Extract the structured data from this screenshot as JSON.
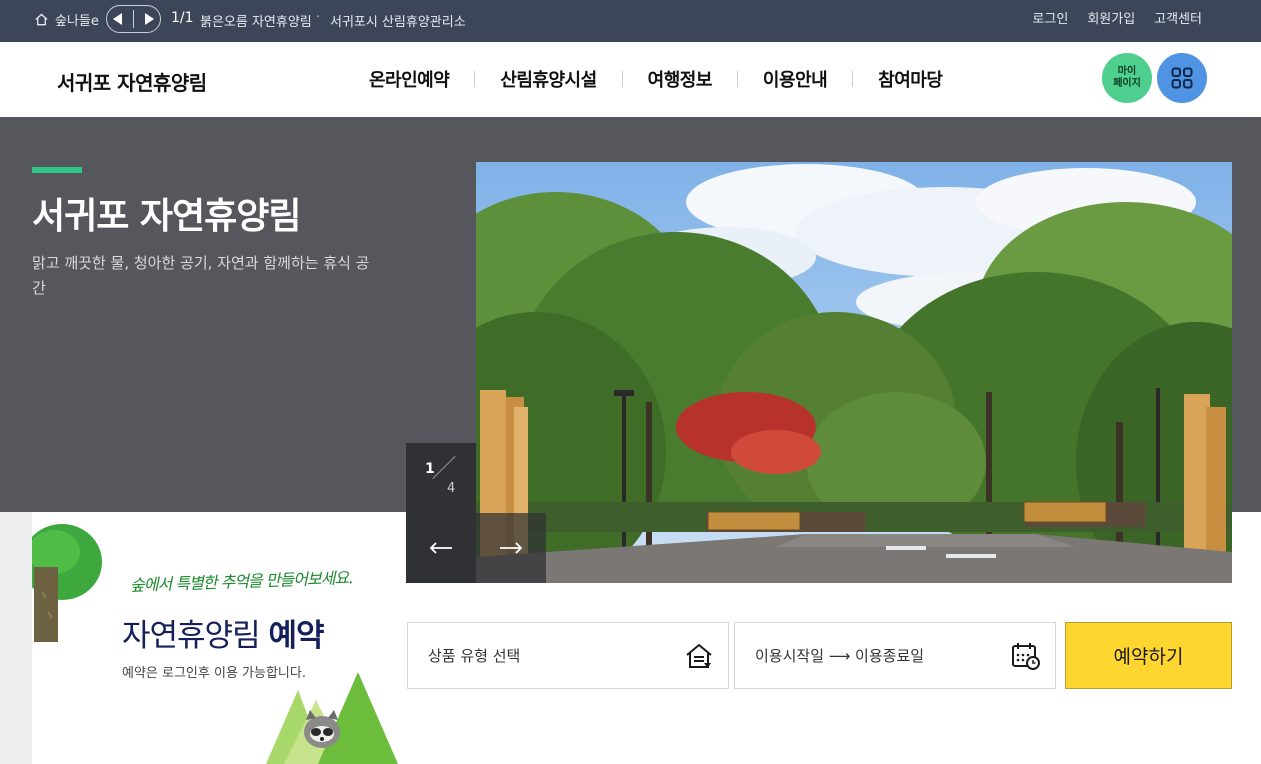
{
  "topbar": {
    "home_label": "숲나들e",
    "count": "1/1",
    "facility": "붉은오름 자연휴양림",
    "separator": "·",
    "office": "서귀포시 산림휴양관리소",
    "util": [
      "로그인",
      "회원가입",
      "고객센터"
    ]
  },
  "header": {
    "logo": "서귀포 자연휴양림",
    "nav": [
      "온라인예약",
      "산림휴양시설",
      "여행정보",
      "이용안내",
      "참여마당"
    ],
    "mypage_line1": "마이",
    "mypage_line2": "페이지"
  },
  "hero": {
    "title": "서귀포 자연휴양림",
    "description": "맑고 깨끗한 물, 청아한 공기, 자연과 함께하는 휴식 공간",
    "slide_current": "1",
    "slide_total": "4",
    "image_alt": "서귀포 자연휴양림 입구 풍경"
  },
  "booking": {
    "handwriting": "숲에서 특별한 추억을 만들어보세요.",
    "title_light": "자연휴양림",
    "title_bold": "예약",
    "note": "예약은 로그인후 이용 가능합니다.",
    "type_placeholder": "상품 유형 선택",
    "date_placeholder": "이용시작일 ⟶ 이용종료일",
    "reserve_label": "예약하기"
  },
  "colors": {
    "topbar_bg": "#3d4659",
    "hero_bg": "#55575c",
    "accent_green": "#2ec585",
    "mypage_green": "#4fcf8d",
    "menu_blue": "#4f93e3",
    "reserve_yellow": "#ffd530",
    "title_navy": "#15205a"
  },
  "icons": {
    "home": "home-icon",
    "prev_top": "triangle-left-icon",
    "next_top": "triangle-right-icon",
    "allmenu": "grid-icon",
    "house": "house-icon",
    "calendar": "calendar-clock-icon",
    "arrow_left": "arrow-left-icon",
    "arrow_right": "arrow-right-icon"
  }
}
